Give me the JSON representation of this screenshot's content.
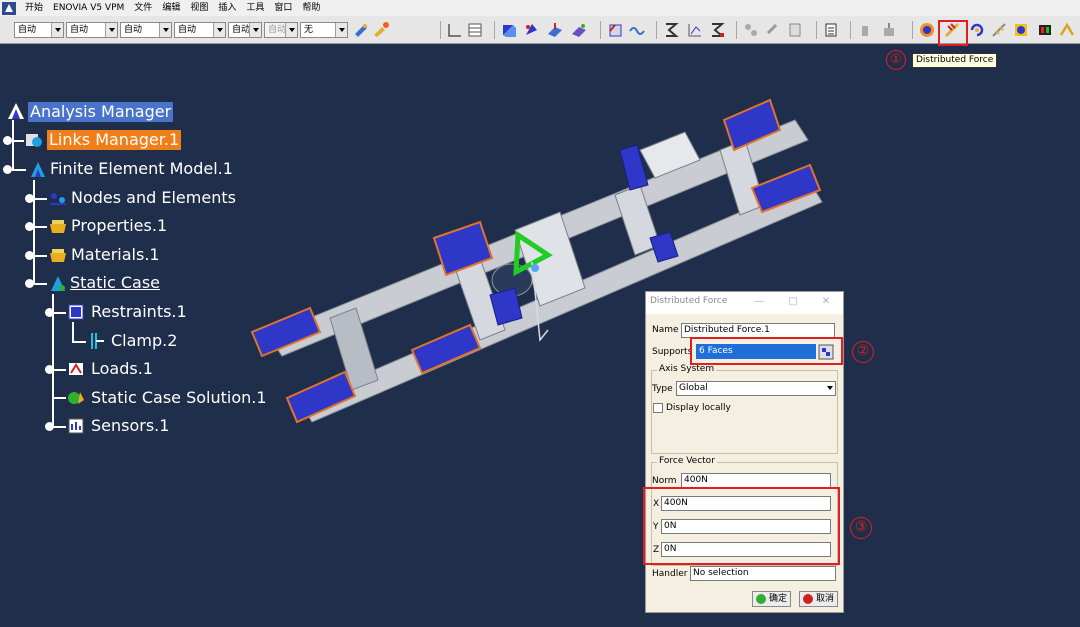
{
  "menu": {
    "home": "开始",
    "items": [
      "ENOVIA V5 VPM",
      "文件",
      "编辑",
      "视图",
      "插入",
      "工具",
      "窗口",
      "帮助"
    ]
  },
  "toolbar": {
    "combos": [
      "自动",
      "自动",
      "自动",
      "自动",
      "自动",
      "自动",
      "无"
    ],
    "tooltip": "Distributed Force"
  },
  "callouts": [
    "①",
    "②",
    "③"
  ],
  "tree": {
    "root": "Analysis Manager",
    "links": "Links Manager.1",
    "fem": "Finite Element Model.1",
    "nodes": "Nodes and Elements",
    "properties": "Properties.1",
    "materials": "Materials.1",
    "static_case": "Static Case",
    "restraints": "Restraints.1",
    "clamp": "Clamp.2",
    "loads": "Loads.1",
    "solution": "Static Case Solution.1",
    "sensors": "Sensors.1"
  },
  "dialog": {
    "title": "Distributed Force",
    "minimize": "—",
    "maximize": "□",
    "close": "✕",
    "name_label": "Name",
    "name_value": "Distributed Force.1",
    "supports_label": "Supports",
    "supports_value": "6 Faces",
    "axis_group": "Axis System",
    "type_label": "Type",
    "type_value": "Global",
    "display_locally": "Display locally",
    "force_group": "Force Vector",
    "norm_label": "Norm",
    "norm_value": "400N",
    "x_label": "X",
    "x_value": "400N",
    "y_label": "Y",
    "y_value": "0N",
    "z_label": "Z",
    "z_value": "0N",
    "handler_label": "Handler",
    "handler_value": "No selection",
    "ok": "确定",
    "cancel": "取消"
  },
  "colors": {
    "background": "#1f2e4a",
    "highlight": "#e02020",
    "selected": "#4a74c9",
    "links_manager": "#f07f1a",
    "plate": "#2f37c8",
    "plate_edge": "#e0742a",
    "frame": "#c9cdd3",
    "axis": "#22cc22"
  }
}
